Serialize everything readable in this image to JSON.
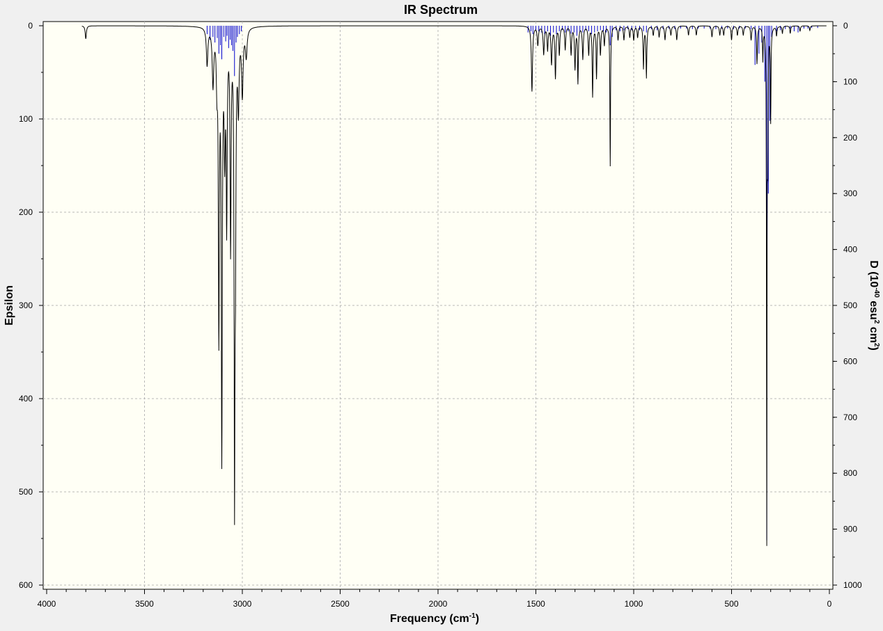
{
  "chart_data": {
    "type": "line",
    "title": "IR Spectrum",
    "xlabel": "Frequency (cm-1)",
    "xlabel_main": "Frequency (cm",
    "xlabel_sup": "-1",
    "xlabel_tail": ")",
    "ylabel_left": "Epsilon",
    "ylabel_right_main": "D (10",
    "ylabel_right_sup1": "-40",
    "ylabel_right_mid": " esu",
    "ylabel_right_sup2": "2",
    "ylabel_right_mid2": " cm",
    "ylabel_right_sup3": "2",
    "ylabel_right_tail": ")",
    "xlim": [
      4000,
      0
    ],
    "ylim_left": [
      0,
      600
    ],
    "ylim_right": [
      0,
      1000
    ],
    "x_direction": "decreasing",
    "y_direction": "inverted",
    "grid": true,
    "background_color": "#fffff5",
    "page_color": "#f0f0f0",
    "spectrum_color": "#000000",
    "stick_color": "#0000cc",
    "x_ticks": [
      "4000",
      "3500",
      "3000",
      "2500",
      "2000",
      "1500",
      "1000",
      "500",
      "0"
    ],
    "x_tick_values": [
      4000,
      3500,
      3000,
      2500,
      2000,
      1500,
      1000,
      500,
      0
    ],
    "y_left_ticks": [
      "0",
      "100",
      "200",
      "300",
      "400",
      "500",
      "600"
    ],
    "y_left_tick_values": [
      0,
      100,
      200,
      300,
      400,
      500,
      600
    ],
    "y_right_ticks": [
      "0",
      "100",
      "200",
      "300",
      "400",
      "500",
      "600",
      "700",
      "800",
      "900",
      "1000"
    ],
    "y_right_tick_values": [
      0,
      100,
      200,
      300,
      400,
      500,
      600,
      700,
      800,
      900,
      1000
    ],
    "series": [
      {
        "kind": "spectrum_peaks_epsilon",
        "peaks": [
          [
            3800,
            14,
            7
          ],
          [
            3180,
            40,
            9
          ],
          [
            3150,
            60,
            9
          ],
          [
            3130,
            50,
            7
          ],
          [
            3120,
            320,
            6
          ],
          [
            3105,
            450,
            6
          ],
          [
            3090,
            120,
            7
          ],
          [
            3080,
            200,
            6
          ],
          [
            3060,
            230,
            6
          ],
          [
            3040,
            470,
            5
          ],
          [
            3035,
            200,
            6
          ],
          [
            3020,
            80,
            8
          ],
          [
            3000,
            70,
            9
          ],
          [
            2980,
            30,
            10
          ],
          [
            1520,
            70,
            7
          ],
          [
            1490,
            20,
            7
          ],
          [
            1460,
            30,
            7
          ],
          [
            1440,
            25,
            6
          ],
          [
            1420,
            40,
            7
          ],
          [
            1400,
            55,
            6
          ],
          [
            1380,
            30,
            6
          ],
          [
            1350,
            25,
            6
          ],
          [
            1320,
            30,
            6
          ],
          [
            1300,
            45,
            6
          ],
          [
            1285,
            60,
            5
          ],
          [
            1260,
            35,
            6
          ],
          [
            1230,
            30,
            6
          ],
          [
            1210,
            75,
            5
          ],
          [
            1190,
            55,
            5
          ],
          [
            1170,
            30,
            6
          ],
          [
            1150,
            20,
            6
          ],
          [
            1120,
            150,
            4
          ],
          [
            1080,
            15,
            6
          ],
          [
            1050,
            15,
            6
          ],
          [
            1020,
            12,
            6
          ],
          [
            1000,
            15,
            6
          ],
          [
            980,
            12,
            6
          ],
          [
            950,
            45,
            5
          ],
          [
            935,
            55,
            5
          ],
          [
            900,
            10,
            6
          ],
          [
            870,
            12,
            6
          ],
          [
            840,
            15,
            6
          ],
          [
            810,
            10,
            6
          ],
          [
            780,
            15,
            6
          ],
          [
            720,
            10,
            6
          ],
          [
            680,
            10,
            6
          ],
          [
            600,
            12,
            6
          ],
          [
            560,
            10,
            6
          ],
          [
            540,
            10,
            6
          ],
          [
            500,
            15,
            6
          ],
          [
            470,
            10,
            6
          ],
          [
            440,
            10,
            6
          ],
          [
            400,
            15,
            6
          ],
          [
            370,
            40,
            5
          ],
          [
            340,
            35,
            4
          ],
          [
            320,
            540,
            3
          ],
          [
            315,
            120,
            4
          ],
          [
            300,
            100,
            4
          ],
          [
            270,
            10,
            5
          ],
          [
            240,
            8,
            5
          ],
          [
            200,
            8,
            5
          ],
          [
            150,
            6,
            5
          ],
          [
            100,
            5,
            5
          ]
        ]
      },
      {
        "kind": "stick_intensities_D",
        "sticks": [
          [
            3180,
            15
          ],
          [
            3165,
            25
          ],
          [
            3150,
            20
          ],
          [
            3140,
            30
          ],
          [
            3128,
            22
          ],
          [
            3120,
            50
          ],
          [
            3112,
            35
          ],
          [
            3105,
            60
          ],
          [
            3095,
            20
          ],
          [
            3085,
            28
          ],
          [
            3078,
            18
          ],
          [
            3070,
            40
          ],
          [
            3062,
            25
          ],
          [
            3055,
            35
          ],
          [
            3048,
            45
          ],
          [
            3040,
            90
          ],
          [
            3032,
            30
          ],
          [
            3025,
            20
          ],
          [
            3015,
            15
          ],
          [
            3005,
            10
          ],
          [
            1540,
            12
          ],
          [
            1525,
            10
          ],
          [
            1515,
            15
          ],
          [
            1500,
            8
          ],
          [
            1485,
            10
          ],
          [
            1470,
            12
          ],
          [
            1455,
            15
          ],
          [
            1440,
            10
          ],
          [
            1425,
            18
          ],
          [
            1410,
            12
          ],
          [
            1395,
            15
          ],
          [
            1380,
            10
          ],
          [
            1365,
            8
          ],
          [
            1350,
            12
          ],
          [
            1335,
            10
          ],
          [
            1320,
            14
          ],
          [
            1305,
            12
          ],
          [
            1290,
            18
          ],
          [
            1275,
            10
          ],
          [
            1260,
            12
          ],
          [
            1245,
            8
          ],
          [
            1230,
            10
          ],
          [
            1215,
            15
          ],
          [
            1200,
            12
          ],
          [
            1185,
            10
          ],
          [
            1170,
            8
          ],
          [
            1155,
            10
          ],
          [
            1140,
            12
          ],
          [
            1120,
            35
          ],
          [
            1110,
            20
          ],
          [
            1090,
            8
          ],
          [
            1070,
            10
          ],
          [
            1050,
            8
          ],
          [
            1030,
            6
          ],
          [
            1010,
            8
          ],
          [
            990,
            6
          ],
          [
            970,
            8
          ],
          [
            950,
            10
          ],
          [
            935,
            12
          ],
          [
            910,
            6
          ],
          [
            880,
            8
          ],
          [
            850,
            6
          ],
          [
            820,
            5
          ],
          [
            790,
            6
          ],
          [
            760,
            5
          ],
          [
            730,
            5
          ],
          [
            700,
            6
          ],
          [
            670,
            5
          ],
          [
            640,
            5
          ],
          [
            610,
            5
          ],
          [
            580,
            6
          ],
          [
            550,
            5
          ],
          [
            520,
            5
          ],
          [
            490,
            6
          ],
          [
            460,
            5
          ],
          [
            430,
            5
          ],
          [
            400,
            6
          ],
          [
            380,
            70
          ],
          [
            360,
            50
          ],
          [
            345,
            30
          ],
          [
            330,
            100
          ],
          [
            320,
            920
          ],
          [
            312,
            300
          ],
          [
            305,
            170
          ],
          [
            295,
            20
          ],
          [
            270,
            10
          ],
          [
            250,
            8
          ],
          [
            225,
            6
          ],
          [
            200,
            5
          ],
          [
            180,
            10
          ],
          [
            160,
            12
          ],
          [
            130,
            5
          ],
          [
            110,
            5
          ],
          [
            90,
            4
          ],
          [
            60,
            4
          ]
        ]
      }
    ]
  }
}
